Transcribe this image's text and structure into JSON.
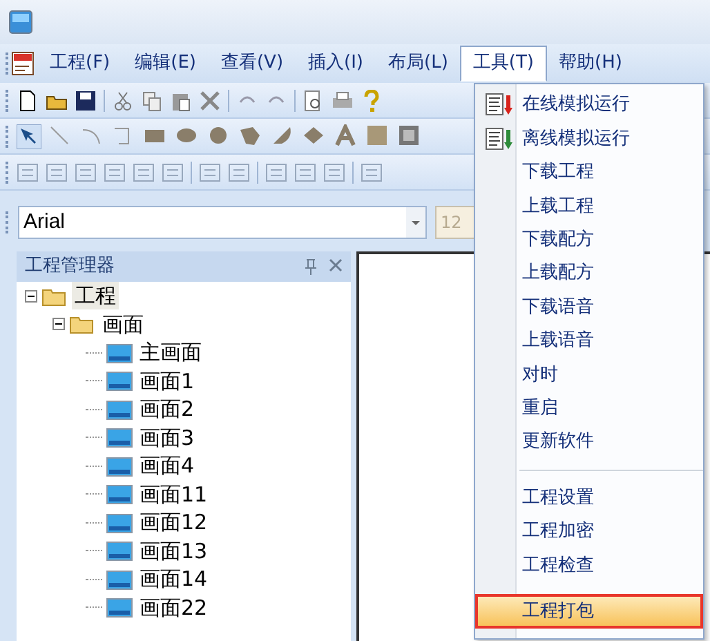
{
  "menubar": [
    {
      "label": "工程(F)",
      "selected": false
    },
    {
      "label": "编辑(E)",
      "selected": false
    },
    {
      "label": "查看(V)",
      "selected": false
    },
    {
      "label": "插入(I)",
      "selected": false
    },
    {
      "label": "布局(L)",
      "selected": false
    },
    {
      "label": "工具(T)",
      "selected": true
    },
    {
      "label": "帮助(H)",
      "selected": false
    }
  ],
  "font_bar": {
    "font_name": "Arial",
    "font_size": "12"
  },
  "project_panel": {
    "title": "工程管理器",
    "tree": [
      {
        "label": "工程",
        "kind": "folder",
        "expanded": true,
        "selected": true,
        "children": [
          {
            "label": "画面",
            "kind": "folder",
            "expanded": true,
            "selected": false,
            "children": [
              {
                "label": "主画面",
                "kind": "screen",
                "selected": false
              },
              {
                "label": "画面1",
                "kind": "screen",
                "selected": false
              },
              {
                "label": "画面2",
                "kind": "screen",
                "selected": false
              },
              {
                "label": "画面3",
                "kind": "screen",
                "selected": false
              },
              {
                "label": "画面4",
                "kind": "screen",
                "selected": false
              },
              {
                "label": "画面11",
                "kind": "screen",
                "selected": false
              },
              {
                "label": "画面12",
                "kind": "screen",
                "selected": false
              },
              {
                "label": "画面13",
                "kind": "screen",
                "selected": false
              },
              {
                "label": "画面14",
                "kind": "screen",
                "selected": false
              },
              {
                "label": "画面22",
                "kind": "screen",
                "selected": false
              }
            ]
          }
        ]
      }
    ]
  },
  "tools_menu": [
    {
      "label": "在线模拟运行",
      "kind": "online",
      "selected": false
    },
    {
      "label": "离线模拟运行",
      "kind": "offline",
      "selected": false
    },
    {
      "label": "下载工程",
      "kind": "plain",
      "selected": false
    },
    {
      "label": "上载工程",
      "kind": "plain",
      "selected": false
    },
    {
      "label": "下载配方",
      "kind": "plain",
      "selected": false
    },
    {
      "label": "上载配方",
      "kind": "plain",
      "selected": false
    },
    {
      "label": "下载语音",
      "kind": "plain",
      "selected": false
    },
    {
      "label": "上载语音",
      "kind": "plain",
      "selected": false
    },
    {
      "label": "对时",
      "kind": "plain",
      "selected": false
    },
    {
      "label": "重启",
      "kind": "plain",
      "selected": false
    },
    {
      "label": "更新软件",
      "kind": "plain",
      "selected": false
    },
    {
      "kind": "separator"
    },
    {
      "label": "工程设置",
      "kind": "plain",
      "selected": false
    },
    {
      "label": "工程加密",
      "kind": "plain",
      "selected": false
    },
    {
      "label": "工程检查",
      "kind": "plain",
      "selected": false
    },
    {
      "label": "工程打包",
      "kind": "plain",
      "selected": true
    }
  ]
}
